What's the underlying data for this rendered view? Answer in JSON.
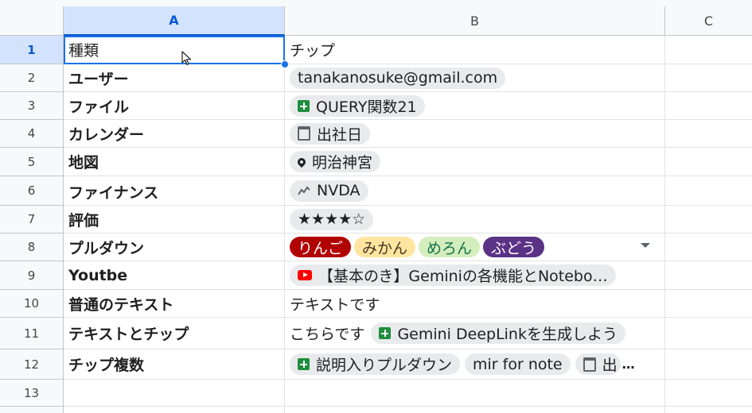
{
  "columns": [
    "A",
    "B",
    "C"
  ],
  "rows": [
    {
      "num": "1",
      "type": "種類",
      "value": "チップ"
    },
    {
      "num": "2",
      "type": "ユーザー",
      "chip": "tanakanosuke@gmail.com"
    },
    {
      "num": "3",
      "type": "ファイル",
      "chip": "QUERY関数21",
      "icon": "sheets-file-icon"
    },
    {
      "num": "4",
      "type": "カレンダー",
      "chip": "出社日",
      "icon": "calendar-icon"
    },
    {
      "num": "5",
      "type": "地図",
      "chip": "明治神宮",
      "icon": "map-pin-icon"
    },
    {
      "num": "6",
      "type": "ファイナンス",
      "chip": "NVDA",
      "icon": "finance-chart-icon"
    },
    {
      "num": "7",
      "type": "評価",
      "chip": "★★★★☆"
    },
    {
      "num": "8",
      "type": "プルダウン",
      "pills": [
        {
          "label": "りんご",
          "bg": "#b10202",
          "fg": "#ffffff"
        },
        {
          "label": "みかん",
          "bg": "#ffe5a0",
          "fg": "#473821"
        },
        {
          "label": "めろん",
          "bg": "#d4edbc",
          "fg": "#11734b"
        },
        {
          "label": "ぶどう",
          "bg": "#5a3286",
          "fg": "#ffffff"
        }
      ]
    },
    {
      "num": "9",
      "type": "Youtbe",
      "chip": "【基本のき】Geminiの各機能とNotebo…",
      "icon": "youtube-icon"
    },
    {
      "num": "10",
      "type": "普通のテキスト",
      "value": "テキストです"
    },
    {
      "num": "11",
      "type": "テキストとチップ",
      "text_prefix": "こちらです",
      "chip": "Gemini DeepLinkを生成しよう",
      "icon": "sheets-file-icon"
    },
    {
      "num": "12",
      "type": "チップ複数",
      "chip": "説明入りプルダウン",
      "icon": "sheets-file-icon",
      "chip2": "mir for note",
      "chip3": "出",
      "more": "…"
    },
    {
      "num": "13"
    }
  ],
  "colors": {
    "accent": "#1a73e8",
    "header_selected": "#d3e3fd",
    "chip_bg": "#e9eaec"
  }
}
